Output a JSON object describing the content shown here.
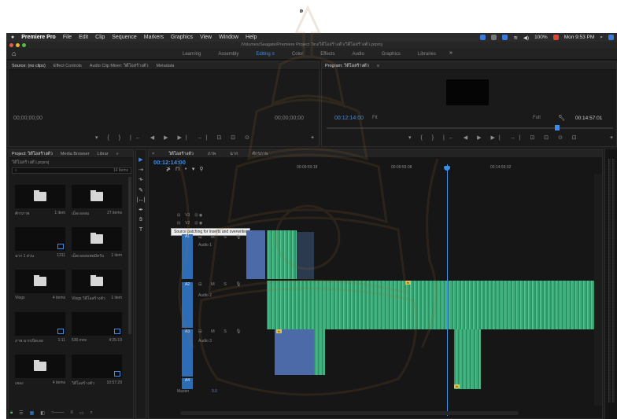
{
  "page_mark": "๑",
  "menubar": {
    "app_name": "Premiere Pro",
    "items": [
      "File",
      "Edit",
      "Clip",
      "Sequence",
      "Markers",
      "Graphics",
      "View",
      "Window",
      "Help"
    ],
    "battery": "100%",
    "clock": "Mon 9:53 PM"
  },
  "window": {
    "title": "/Volumes/Seagate/Premiere Project Tiru/วิดีโอสร้างตัว/วิดีโอสร้างตัว.prproj"
  },
  "workspaces": {
    "tabs": [
      "Learning",
      "Assembly",
      "Editing",
      "Color",
      "Effects",
      "Audio",
      "Graphics",
      "Libraries"
    ],
    "active": "Editing",
    "more": "»"
  },
  "source": {
    "tabs": [
      "Source: (no clips)",
      "Effect Controls",
      "Audio Clip Mixer: วิดีโอสร้างตัว",
      "Metadata"
    ],
    "timecode_in": "00;00;00;00",
    "timecode_out": "00;00;00;00"
  },
  "program": {
    "tab": "Program: วิดีโอสร้างตัว",
    "timecode": "00:12:14:00",
    "fit": "Fit",
    "full": "Full",
    "duration": "00:14:57:01"
  },
  "project": {
    "tabs": [
      "Project: วิดีโอสร้างตัว",
      "Media Browser",
      "Librar",
      "»"
    ],
    "file": "วิดีโอสร้างตัว.prproj",
    "count": "14 Items",
    "search_placeholder": "",
    "bins": [
      {
        "name": "ศักรภาพ",
        "meta": "1 item",
        "type": "folder"
      },
      {
        "name": "เม็ดเจลลม",
        "meta": "27 items",
        "type": "folder"
      },
      {
        "name": "ฉาก 1 ส่วน",
        "meta": "1311",
        "type": "clip"
      },
      {
        "name": "เม็ดเจลลมพอมีครับ",
        "meta": "1 item",
        "type": "folder"
      },
      {
        "name": "Vlogs",
        "meta": "4 items",
        "type": "folder"
      },
      {
        "name": "Vlogs วิดีโอสร้างตัว",
        "meta": "1 item",
        "type": "folder"
      },
      {
        "name": "ภาพ ฉากเปิดเลย",
        "meta": "1:11",
        "type": "clip"
      },
      {
        "name": "530.mov",
        "meta": "4:25:19",
        "type": "clip"
      },
      {
        "name": "เพลง",
        "meta": "4 items",
        "type": "folder"
      },
      {
        "name": "วิดีโอสร้างตัว",
        "meta": "10:57:29",
        "type": "clip"
      }
    ]
  },
  "timeline": {
    "tabs": [
      "วิดีโอสร้างตัว",
      "ภาพ",
      "ฉาก",
      "ศักรภาพ"
    ],
    "timecode": "00:12:14:00",
    "ruler": [
      "00:09:59:18",
      "00:09:59:08",
      "00:14:59:02"
    ],
    "tracks": [
      "V3",
      "V2",
      "V1",
      "A1",
      "A2",
      "A3"
    ],
    "audio_labels": [
      "Audio 1",
      "Audio 2",
      "Audio 3"
    ],
    "tooltip": "Source patching for inserts and overwrites",
    "master": "Master",
    "master_value": "0.0"
  }
}
